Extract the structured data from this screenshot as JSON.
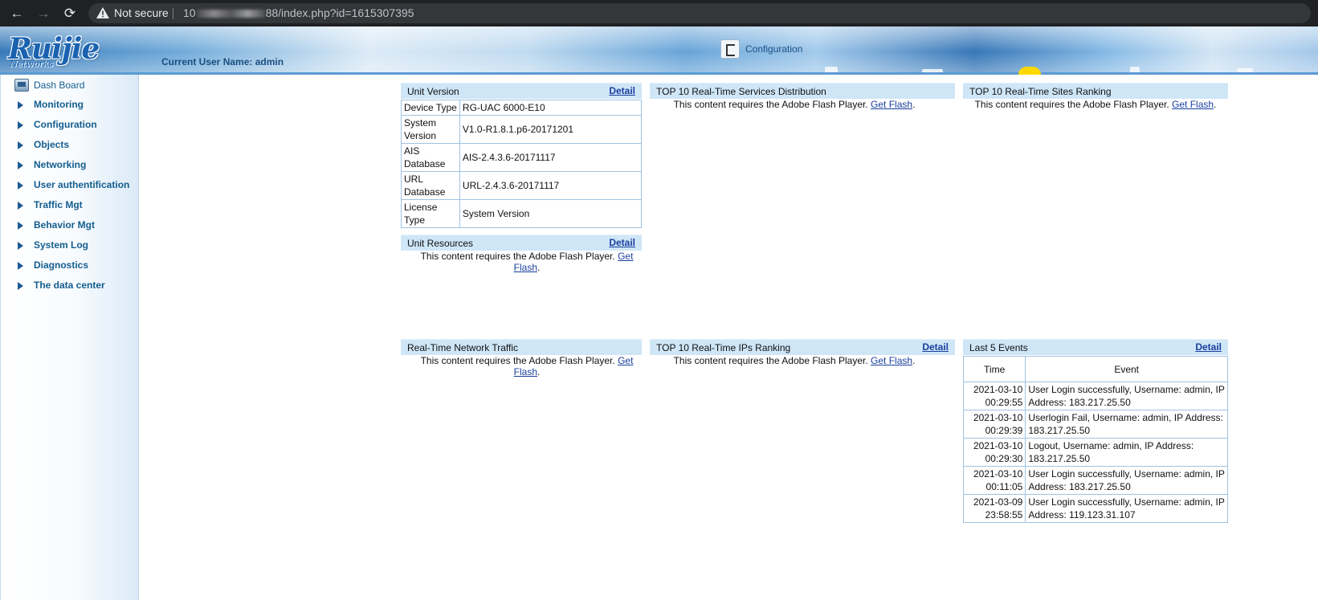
{
  "browser": {
    "back_icon": "←",
    "forward_icon": "→",
    "reload_icon": "⟳",
    "security_label": "Not secure",
    "url_prefix": "10",
    "url_suffix": "88/index.php?id=1615307395"
  },
  "header": {
    "logo": "Ruijie",
    "logo_sub": "Networks",
    "user_line": "Current User Name: admin",
    "section_tab": "Configuration"
  },
  "sidebar": {
    "items": [
      {
        "label": "Dash Board"
      },
      {
        "label": "Monitoring"
      },
      {
        "label": "Configuration"
      },
      {
        "label": "Objects"
      },
      {
        "label": "Networking"
      },
      {
        "label": "User authentification"
      },
      {
        "label": "Traffic Mgt"
      },
      {
        "label": "Behavior Mgt"
      },
      {
        "label": "System Log"
      },
      {
        "label": "Diagnostics"
      },
      {
        "label": "The data center"
      }
    ]
  },
  "flash": {
    "message": "This content requires the Adobe Flash Player.",
    "link": "Get Flash",
    "suffix": "."
  },
  "panels": {
    "unit_version": {
      "title": "Unit Version",
      "detail": "Detail",
      "rows": [
        {
          "key": "Device Type",
          "value": "RG-UAC 6000-E10"
        },
        {
          "key": "System Version",
          "value": "V1.0-R1.8.1.p6-20171201"
        },
        {
          "key": "AIS Database",
          "value": "AIS-2.4.3.6-20171117"
        },
        {
          "key": "URL Database",
          "value": "URL-2.4.3.6-20171117"
        },
        {
          "key": "License Type",
          "value": "System Version"
        }
      ]
    },
    "services_distribution": {
      "title": "TOP 10 Real-Time Services Distribution"
    },
    "sites_ranking": {
      "title": "TOP 10 Real-Time Sites Ranking"
    },
    "unit_resources": {
      "title": "Unit Resources",
      "detail": "Detail"
    },
    "network_traffic": {
      "title": "Real-Time Network Traffic"
    },
    "ips_ranking": {
      "title": "TOP 10 Real-Time IPs Ranking",
      "detail": "Detail"
    },
    "last_events": {
      "title": "Last 5 Events",
      "detail": "Detail",
      "col_time": "Time",
      "col_event": "Event",
      "rows": [
        {
          "date": "2021-03-10",
          "time": "00:29:55",
          "event": "User Login successfully, Username: admin, IP Address: 183.217.25.50"
        },
        {
          "date": "2021-03-10",
          "time": "00:29:39",
          "event": "Userlogin Fail, Username: admin, IP Address: 183.217.25.50"
        },
        {
          "date": "2021-03-10",
          "time": "00:29:30",
          "event": "Logout, Username: admin, IP Address: 183.217.25.50"
        },
        {
          "date": "2021-03-10",
          "time": "00:11:05",
          "event": "User Login successfully, Username: admin, IP Address: 183.217.25.50"
        },
        {
          "date": "2021-03-09",
          "time": "23:58:55",
          "event": "User Login successfully, Username: admin, IP Address: 119.123.31.107"
        }
      ]
    }
  }
}
